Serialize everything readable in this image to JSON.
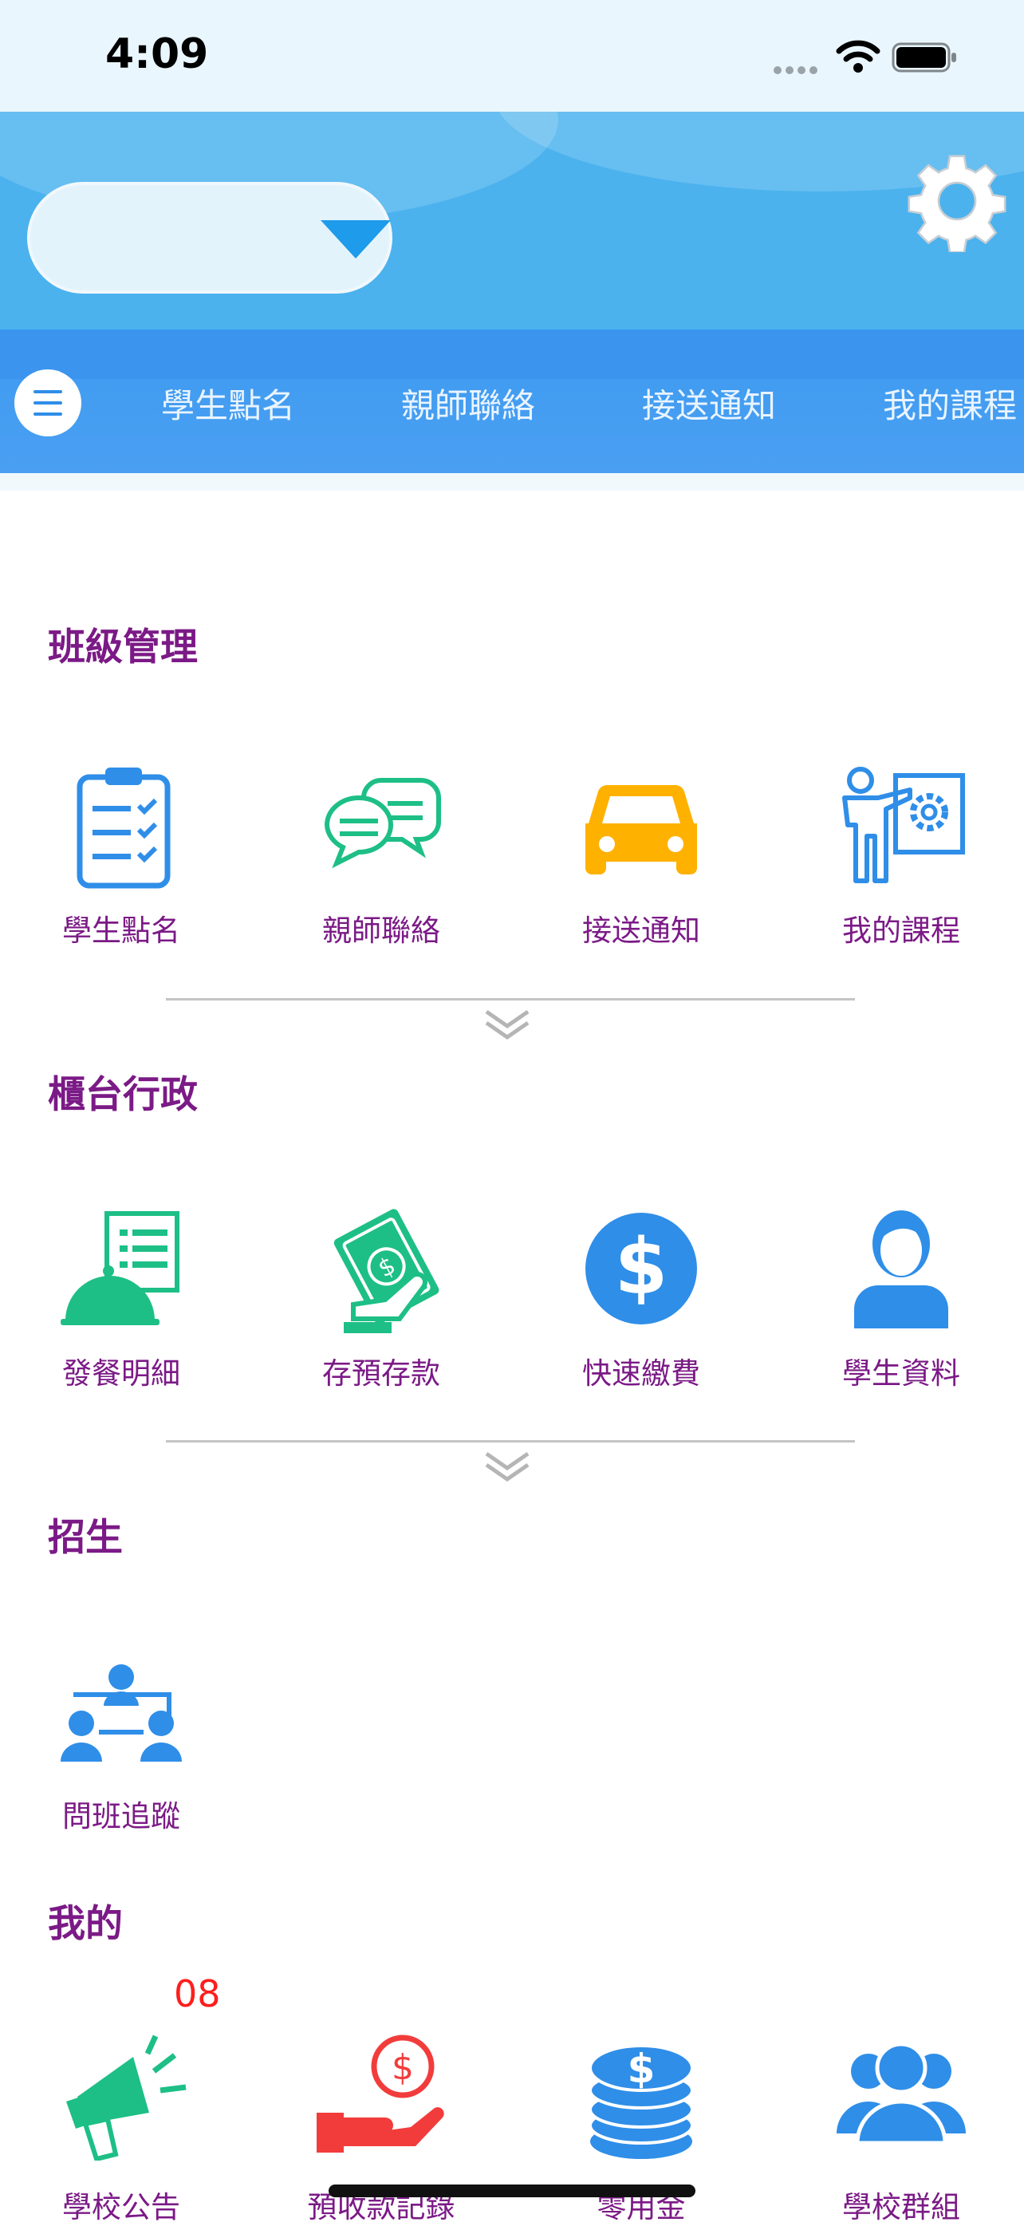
{
  "status_bar": {
    "time": "4:09"
  },
  "header": {
    "location_selector_value": ""
  },
  "nav": {
    "items": [
      "學生點名",
      "親師聯絡",
      "接送通知",
      "我的課程"
    ]
  },
  "sections": [
    {
      "title": "班級管理",
      "items": [
        {
          "label": "學生點名",
          "icon": "clipboard-checklist-icon"
        },
        {
          "label": "親師聯絡",
          "icon": "chat-bubbles-icon"
        },
        {
          "label": "接送通知",
          "icon": "car-icon"
        },
        {
          "label": "我的課程",
          "icon": "teacher-board-icon"
        }
      ]
    },
    {
      "title": "櫃台行政",
      "items": [
        {
          "label": "發餐明細",
          "icon": "meal-cloche-list-icon"
        },
        {
          "label": "存預存款",
          "icon": "money-hand-icon"
        },
        {
          "label": "快速繳費",
          "icon": "dollar-coin-icon"
        },
        {
          "label": "學生資料",
          "icon": "student-person-icon"
        }
      ]
    },
    {
      "title": "招生",
      "items": [
        {
          "label": "問班追蹤",
          "icon": "team-meeting-icon"
        }
      ]
    },
    {
      "title": "我的",
      "items": [
        {
          "label": "學校公告",
          "icon": "megaphone-icon",
          "badge": "08"
        },
        {
          "label": "預收款記錄",
          "icon": "hand-coin-icon"
        },
        {
          "label": "零用金",
          "icon": "coin-stack-icon"
        },
        {
          "label": "學校群組",
          "icon": "group-people-icon"
        }
      ]
    }
  ],
  "colors": {
    "header_blue": "#4bb2ee",
    "nav_blue": "#3d9bf0",
    "section_title": "#7b1a86",
    "icon_blue": "#2f8ee8",
    "icon_green": "#1dbf86",
    "icon_yellow": "#ffb100",
    "badge_red": "#ff1d1d"
  }
}
